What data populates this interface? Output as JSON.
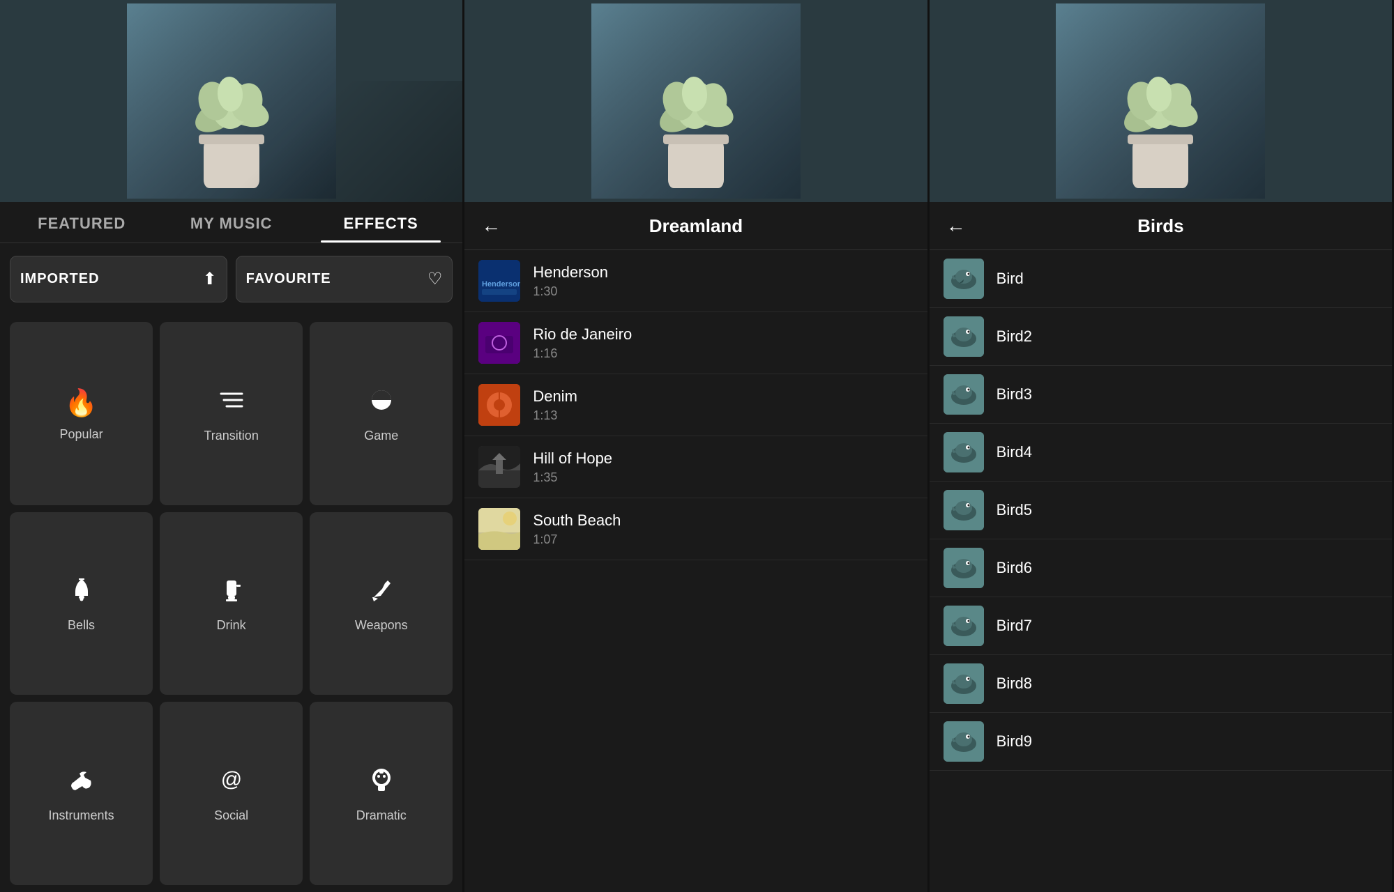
{
  "panel1": {
    "hero_alt": "Plant in pot",
    "tabs": [
      {
        "label": "FEATURED",
        "active": false
      },
      {
        "label": "MY MUSIC",
        "active": false
      },
      {
        "label": "EFFECTS",
        "active": true
      }
    ],
    "buttons": {
      "imported": "IMPORTED",
      "favourite": "FAVOURITE"
    },
    "grid": [
      {
        "id": "popular",
        "label": "Popular",
        "icon": "🔥"
      },
      {
        "id": "transition",
        "label": "Transition",
        "icon": "≡"
      },
      {
        "id": "game",
        "label": "Game",
        "icon": "👾"
      },
      {
        "id": "bells",
        "label": "Bells",
        "icon": "🔔"
      },
      {
        "id": "drink",
        "label": "Drink",
        "icon": "🥤"
      },
      {
        "id": "weapons",
        "label": "Weapons",
        "icon": "🪓"
      },
      {
        "id": "instruments",
        "label": "Instruments",
        "icon": "🎺"
      },
      {
        "id": "social",
        "label": "Social",
        "icon": "@"
      },
      {
        "id": "dramatic",
        "label": "Dramatic",
        "icon": "🎭"
      }
    ]
  },
  "panel2": {
    "back_label": "←",
    "title": "Dreamland",
    "items": [
      {
        "title": "Henderson",
        "duration": "1:30",
        "thumb_class": "henderson"
      },
      {
        "title": "Rio de Janeiro",
        "duration": "1:16",
        "thumb_class": "rio"
      },
      {
        "title": "Denim",
        "duration": "1:13",
        "thumb_class": "denim"
      },
      {
        "title": "Hill of Hope",
        "duration": "1:35",
        "thumb_class": "hillofhope"
      },
      {
        "title": "South Beach",
        "duration": "1:07",
        "thumb_class": "southbeach"
      }
    ]
  },
  "panel3": {
    "back_label": "←",
    "title": "Birds",
    "items": [
      {
        "name": "Bird"
      },
      {
        "name": "Bird2"
      },
      {
        "name": "Bird3"
      },
      {
        "name": "Bird4"
      },
      {
        "name": "Bird5"
      },
      {
        "name": "Bird6"
      },
      {
        "name": "Bird7"
      },
      {
        "name": "Bird8"
      },
      {
        "name": "Bird9"
      }
    ]
  }
}
